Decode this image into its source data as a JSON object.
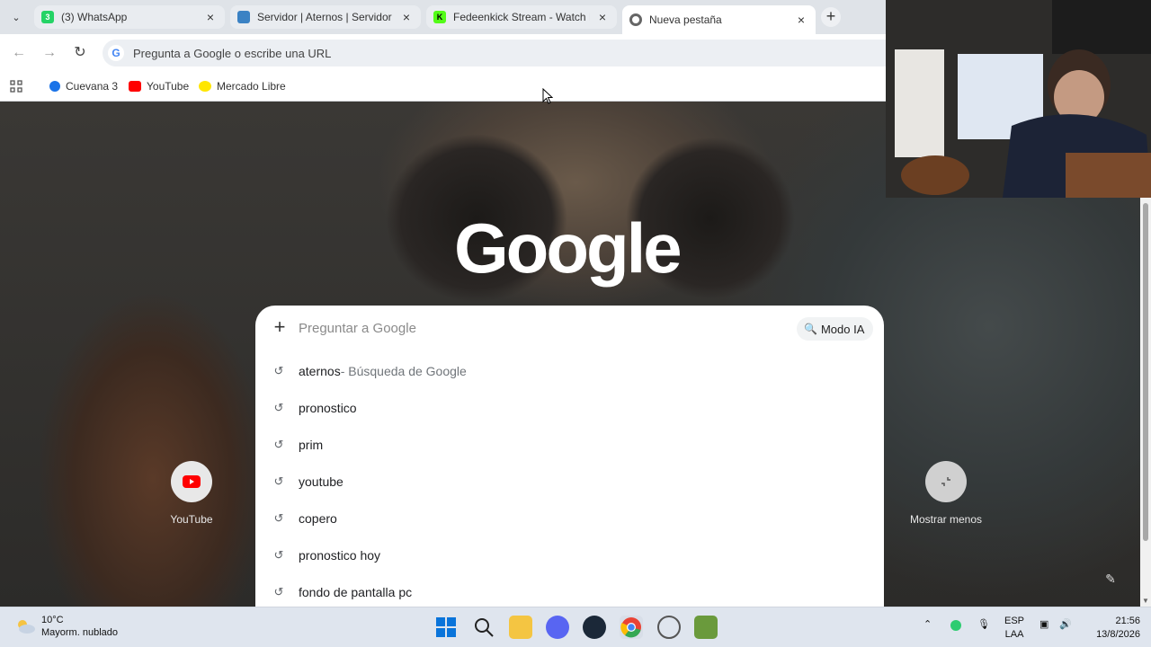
{
  "browser": {
    "tabs": [
      {
        "title": "(3) WhatsApp",
        "badge": "3",
        "favicon": "whatsapp-icon"
      },
      {
        "title": "Servidor | Aternos | Servidor gratis de Minecraft",
        "favicon": "aternos-icon"
      },
      {
        "title": "Fedeenkick Stream - Watch Live",
        "favicon": "kick-icon"
      },
      {
        "title": "Nueva pestaña",
        "favicon": "chrome-icon"
      }
    ],
    "omnibox_placeholder": "Pregunta a Google o escribe una URL",
    "bookmarks": [
      {
        "label": "Cuevana 3",
        "icon": "cuevana-icon"
      },
      {
        "label": "YouTube",
        "icon": "youtube-icon"
      },
      {
        "label": "Mercado Libre",
        "icon": "mercadolibre-icon"
      }
    ]
  },
  "ntp": {
    "logo": "Google",
    "search_placeholder": "Preguntar a Google",
    "ai_mode_label": "Modo IA",
    "suggestions": [
      {
        "text": "aternos",
        "extra": " - Búsqueda de Google"
      },
      {
        "text": "pronostico"
      },
      {
        "text": "prim"
      },
      {
        "text": "youtube"
      },
      {
        "text": "copero"
      },
      {
        "text": "pronostico hoy"
      },
      {
        "text": "fondo de pantalla pc"
      }
    ],
    "shortcuts": [
      {
        "label": "YouTube"
      },
      {
        "label": "Mostrar menos"
      }
    ]
  },
  "taskbar": {
    "weather_temp": "10°C",
    "weather_desc": "Mayorm. nublado",
    "lang_top": "ESP",
    "lang_bottom": "LAA",
    "time": "21:56",
    "date": "13/8/2026"
  },
  "colors": {
    "whatsapp": "#25d366",
    "kick": "#53fc18",
    "youtube": "#ff0000",
    "google_blue": "#4285f4"
  }
}
